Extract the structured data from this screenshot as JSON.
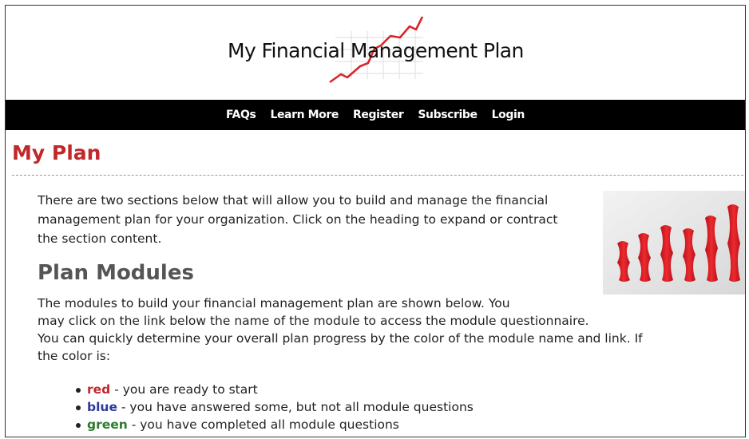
{
  "header": {
    "logo_text": "My Financial Management Plan"
  },
  "nav": {
    "items": [
      {
        "label": "FAQs"
      },
      {
        "label": "Learn More"
      },
      {
        "label": "Register"
      },
      {
        "label": "Subscribe"
      },
      {
        "label": "Login"
      }
    ]
  },
  "page": {
    "title": "My Plan",
    "intro": "There are two sections below that will allow you to build and manage the financial management plan for your organization. Click on the heading to expand or contract the section content.",
    "section_heading": "Plan Modules",
    "modules_line1": "The modules to build your financial management plan are shown below.  You",
    "modules_line2": "may click on the link below the name of the module to access the module questionnaire.",
    "modules_line3": "You can quickly determine your overall plan progress by the color of the module name and link. If",
    "modules_line4": "the color is:"
  },
  "legend": [
    {
      "color_word": "red",
      "description": " - you are ready to start",
      "color": "#c0282a"
    },
    {
      "color_word": "blue",
      "description": " - you have answered some, but not all module questions",
      "color": "#2a3a9a"
    },
    {
      "color_word": "green",
      "description": " - you have completed all module questions",
      "color": "#2e7a2e"
    }
  ],
  "icons": {
    "logo_graph": "rising-line-chart-icon",
    "bars_image": "red-wavy-bars-image"
  }
}
